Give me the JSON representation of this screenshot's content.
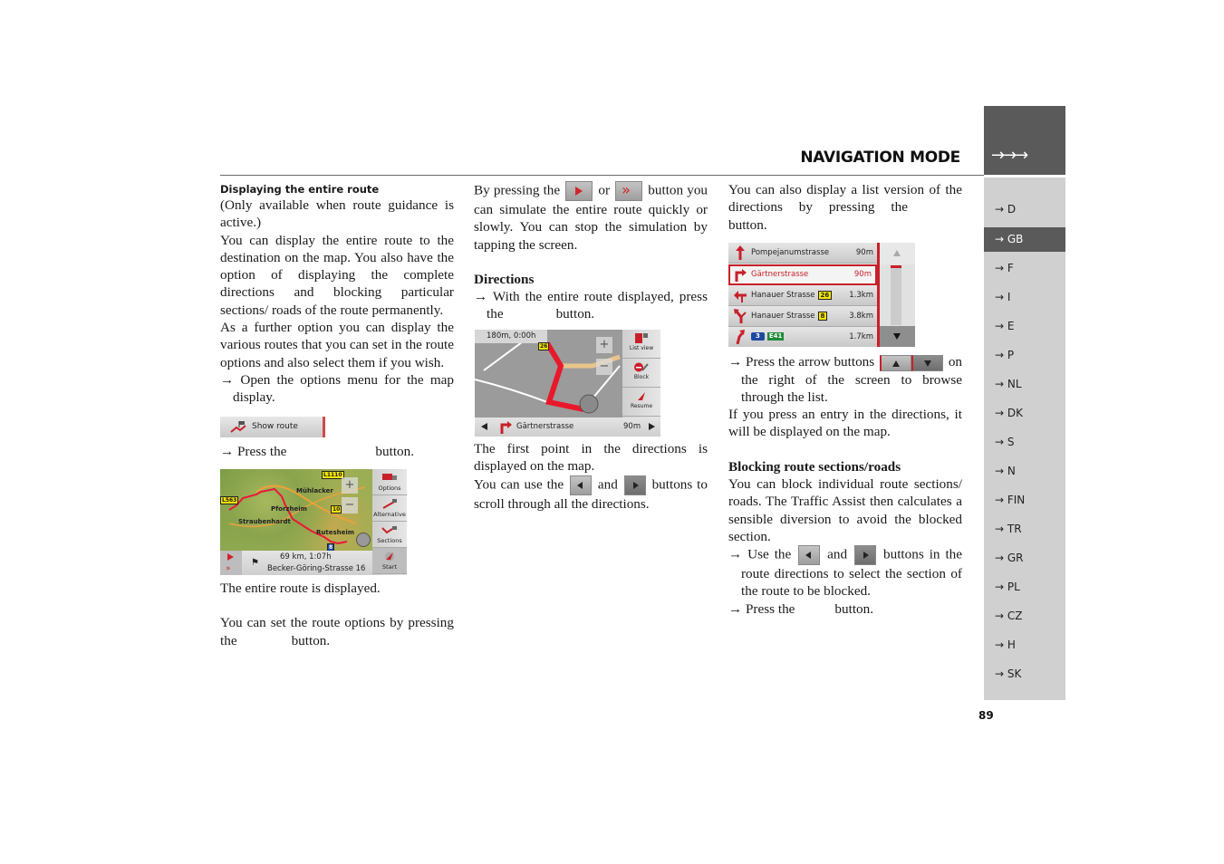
{
  "header": {
    "title": "NAVIGATION MODE",
    "tab_arrows": "→→→"
  },
  "languages": [
    {
      "label": "→ D",
      "active": false
    },
    {
      "label": "→ GB",
      "active": true
    },
    {
      "label": "→ F",
      "active": false
    },
    {
      "label": "→ I",
      "active": false
    },
    {
      "label": "→ E",
      "active": false
    },
    {
      "label": "→ P",
      "active": false
    },
    {
      "label": "→ NL",
      "active": false
    },
    {
      "label": "→ DK",
      "active": false
    },
    {
      "label": "→ S",
      "active": false
    },
    {
      "label": "→ N",
      "active": false
    },
    {
      "label": "→ FIN",
      "active": false
    },
    {
      "label": "→ TR",
      "active": false
    },
    {
      "label": "→ GR",
      "active": false
    },
    {
      "label": "→ PL",
      "active": false
    },
    {
      "label": "→ CZ",
      "active": false
    },
    {
      "label": "→ H",
      "active": false
    },
    {
      "label": "→ SK",
      "active": false
    }
  ],
  "page_number": "89",
  "col1": {
    "heading": "Displaying the entire route",
    "p1": "(Only available when route guidance is active.)",
    "p2": "You can display the entire route to the destination on the map. You also have the option of displaying the complete directions and blocking particular sections/ roads of the route permanently.",
    "p3": "As a further option you can display the various routes that you can set in the route options and also select them if you wish.",
    "step1": "→ Open the options menu for the map display.",
    "show_route_label": "Show route",
    "step2_a": "→ Press the",
    "step2_b": "button.",
    "caption": "The entire route is displayed.",
    "p4_a": "You can set the route options by pressing the",
    "p4_b": "button."
  },
  "shot1": {
    "distance_time": "69 km, 1:07h",
    "destination": "Becker-Göring-Strasse 16",
    "buttons": [
      "Options",
      "Alternative",
      "Sections",
      "Start"
    ],
    "places": [
      "Mühlacker",
      "Pforzheim",
      "Straubenhardt",
      "Rutesheim"
    ],
    "road_tags": [
      "L1110",
      "10",
      "L563",
      "8"
    ],
    "zoom_in": "+",
    "zoom_out": "−"
  },
  "col2": {
    "p1_a": "By pressing the",
    "p1_or": "or",
    "p1_b": "button you can simulate the entire route quickly or slowly. You can stop the simulation by tapping the screen.",
    "heading": "Directions",
    "step1_a": "→ With the entire route displayed, press the",
    "step1_b": "button.",
    "p2": "The first point in the directions is displayed on the map.",
    "p3_a": "You can use the",
    "p3_and": "and",
    "p3_b": "buttons to scroll through all the directions."
  },
  "shot2": {
    "top_info": "180m,   0:00h",
    "street": "Gärtnerstrasse",
    "distance": "90m",
    "buttons": [
      "List view",
      "Block",
      "Resume"
    ],
    "road_tag": "26",
    "zoom_in": "+",
    "zoom_out": "−"
  },
  "col3": {
    "p1_a": "You can also display a list version of the directions by pressing the",
    "p1_b": "button.",
    "step1_a": "→ Press the arrow buttons",
    "step1_b": "on the right of the screen to browse through the list.",
    "p2": "If you press an entry in the directions, it will be displayed on the map.",
    "heading": "Blocking route sections/roads",
    "p3": "You can block individual route sections/ roads. The Traffic Assist then calculates a sensible diversion to avoid the blocked section.",
    "step2_a": "→ Use the",
    "step2_and": "and",
    "step2_b": "buttons in the route directions to select the section of the route to be blocked.",
    "step3_a": "→ Press the",
    "step3_b": "button."
  },
  "shot3": {
    "rows": [
      {
        "name": "Pompejanumstrasse",
        "shield": "",
        "shield2": "",
        "distance": "90m",
        "selected": false
      },
      {
        "name": "Gärtnerstrasse",
        "shield": "",
        "shield2": "",
        "distance": "90m",
        "selected": true
      },
      {
        "name": "Hanauer Strasse",
        "shield": "26",
        "shield2": "",
        "distance": "1.3km",
        "selected": false
      },
      {
        "name": "Hanauer Strasse",
        "shield": "8",
        "shield2": "",
        "distance": "3.8km",
        "selected": false
      },
      {
        "name": "",
        "shield": "3",
        "shield2": "E41",
        "distance": "1.7km",
        "selected": false
      }
    ]
  },
  "colors": {
    "accent_red": "#c8202a",
    "tab_dark": "#5a5a5a",
    "tab_light": "#d0d0d0"
  }
}
